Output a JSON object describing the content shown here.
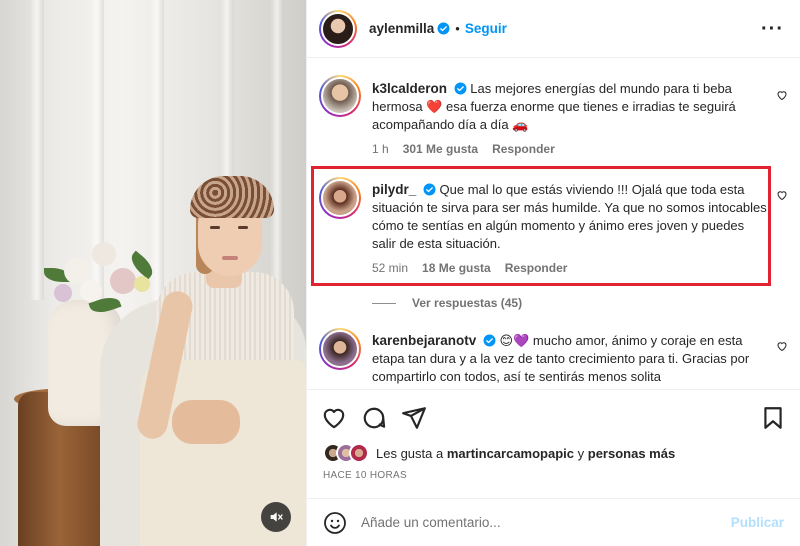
{
  "post": {
    "author": "aylenmilla",
    "separator": "•",
    "follow_label": "Seguir",
    "more_icon": "more-horizontal-icon"
  },
  "comments": [
    {
      "username": "k3lcalderon",
      "verified": true,
      "text": "Las mejores energías del mundo para ti beba hermosa ❤️ esa fuerza enorme que tienes e irradias te seguirá acompañando día a día 🚗",
      "time": "1 h",
      "likes": "301 Me gusta",
      "reply": "Responder"
    },
    {
      "username": "pilydr_",
      "verified": true,
      "text": "Que mal lo que estás viviendo !!! Ojalá que toda esta situación te sirva para ser más humilde. Ya que no somos intocables cómo te sentías en algún momento y ánimo eres joven y puedes salir de esta situación.",
      "time": "52 min",
      "likes": "18 Me gusta",
      "reply": "Responder",
      "highlighted": true,
      "highlight_color": "#e0232e"
    },
    {
      "username": "karenbejaranotv",
      "verified": true,
      "text": "😊💜 mucho amor, ánimo y coraje en esta etapa tan dura y a la vez de tanto crecimiento para ti. Gracias por compartirlo con todos, así te sentirás menos solita"
    }
  ],
  "view_replies": "Ver respuestas (45)",
  "likes_summary": {
    "prefix": "Les gusta a",
    "user": "martincarcamopapic",
    "connector": "y",
    "rest": "personas más"
  },
  "timestamp": "HACE 10 HORAS",
  "composer": {
    "placeholder": "Añade un comentario...",
    "publish_label": "Publicar"
  },
  "colors": {
    "accent": "#0095f6",
    "publish_disabled": "#b2dffc",
    "verified": "#0095f6",
    "heart_red": "#ed4956",
    "highlight": "#e0232e"
  }
}
